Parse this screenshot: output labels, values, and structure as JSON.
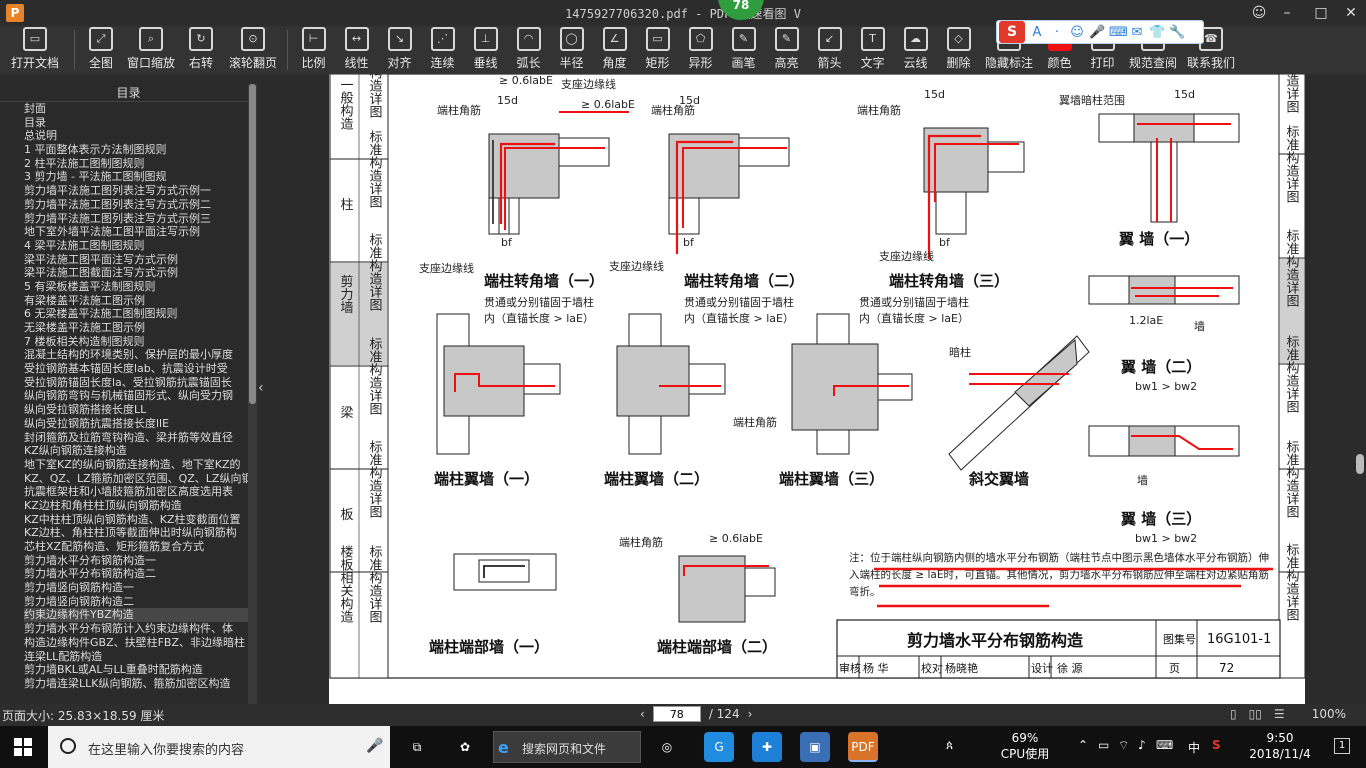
{
  "window": {
    "app_logo": "P",
    "title": "1475927706320.pdf - PDF 快速看图 V",
    "page_badge": "78",
    "buttons": [
      "user-icon",
      "minimize-icon",
      "maximize-icon",
      "close-icon"
    ]
  },
  "ime_bar": {
    "logo": "S",
    "glyphs": [
      "A",
      "·",
      "☺",
      "🎤",
      "⌨",
      "✉",
      "👕",
      "🔧"
    ]
  },
  "toolbar": {
    "items": [
      {
        "label": "打开文档",
        "icon": "folder-icon"
      },
      {
        "label": "全图",
        "icon": "fit-page-icon"
      },
      {
        "label": "窗口缩放",
        "icon": "zoom-icon"
      },
      {
        "label": "右转",
        "icon": "rotate-icon"
      },
      {
        "label": "滚轮翻页",
        "icon": "mouse-icon"
      },
      {
        "label": "比例",
        "icon": "scale-icon"
      },
      {
        "label": "线性",
        "icon": "linear-measure-icon"
      },
      {
        "label": "对齐",
        "icon": "align-measure-icon"
      },
      {
        "label": "连续",
        "icon": "continuous-measure-icon"
      },
      {
        "label": "垂线",
        "icon": "perpendicular-icon"
      },
      {
        "label": "弧长",
        "icon": "arc-length-icon"
      },
      {
        "label": "半径",
        "icon": "radius-icon"
      },
      {
        "label": "角度",
        "icon": "angle-icon"
      },
      {
        "label": "矩形",
        "icon": "rectangle-icon"
      },
      {
        "label": "异形",
        "icon": "polygon-icon"
      },
      {
        "label": "画笔",
        "icon": "pen-icon"
      },
      {
        "label": "高亮",
        "icon": "highlight-icon"
      },
      {
        "label": "箭头",
        "icon": "arrow-icon"
      },
      {
        "label": "文字",
        "icon": "text-icon"
      },
      {
        "label": "云线",
        "icon": "cloud-icon"
      },
      {
        "label": "删除",
        "icon": "eraser-icon"
      },
      {
        "label": "隐藏标注",
        "icon": "hide-annotation-icon"
      },
      {
        "label": "颜色",
        "icon": "color-swatch-icon"
      },
      {
        "label": "打印",
        "icon": "print-icon"
      },
      {
        "label": "规范查阅",
        "icon": "spec-lookup-icon"
      },
      {
        "label": "联系我们",
        "icon": "contact-icon"
      }
    ],
    "accent_color": "#ee1111"
  },
  "sidebar": {
    "header": "目录",
    "selected_index": 44,
    "items": [
      {
        "label": "封面",
        "expandable": false
      },
      {
        "label": "目录",
        "expandable": false
      },
      {
        "label": "总说明",
        "expandable": false
      },
      {
        "label": "1 平面整体表示方法制图规则",
        "expandable": false
      },
      {
        "label": "2 柱平法施工图制图规则",
        "expandable": true
      },
      {
        "label": "3 剪力墙 - 平法施工图制图规",
        "expandable": true
      },
      {
        "label": "剪力墙平法施工图列表注写方式示例一",
        "expandable": false
      },
      {
        "label": "剪力墙平法施工图列表注写方式示例二",
        "expandable": false
      },
      {
        "label": "剪力墙平法施工图列表注写方式示例三",
        "expandable": false
      },
      {
        "label": "地下室外墙平法施工图平面注写示例",
        "expandable": false
      },
      {
        "label": "4 梁平法施工图制图规则",
        "expandable": true
      },
      {
        "label": "梁平法施工图平面注写方式示例",
        "expandable": false
      },
      {
        "label": "梁平法施工图截面注写方式示例",
        "expandable": false
      },
      {
        "label": "5 有梁板楼盖平法制图规则",
        "expandable": true
      },
      {
        "label": "有梁楼盖平法施工图示例",
        "expandable": false
      },
      {
        "label": "6 无梁楼盖平法施工图制图规则",
        "expandable": true
      },
      {
        "label": "无梁楼盖平法施工图示例",
        "expandable": false
      },
      {
        "label": "7 楼板相关构造制图规则",
        "expandable": true
      },
      {
        "label": "混凝土结构的环境类别、保护层的最小厚度",
        "expandable": false
      },
      {
        "label": "受拉钢筋基本锚固长度lab、抗震设计时受",
        "expandable": false
      },
      {
        "label": "受拉钢筋锚固长度la、受拉钢筋抗震锚固长",
        "expandable": false
      },
      {
        "label": "纵向钢筋弯钩与机械锚固形式、纵向受力钢",
        "expandable": false
      },
      {
        "label": "纵向受拉钢筋搭接长度LL",
        "expandable": false
      },
      {
        "label": "纵向受拉钢筋抗震搭接长度llE",
        "expandable": false
      },
      {
        "label": "封闭箍筋及拉筋弯钩构造、梁并筋等效直径",
        "expandable": false
      },
      {
        "label": "KZ纵向钢筋连接构造",
        "expandable": false
      },
      {
        "label": "地下室KZ的纵向钢筋连接构造、地下室KZ的",
        "expandable": false
      },
      {
        "label": "KZ、QZ、LZ箍筋加密区范围、QZ、LZ纵向钢",
        "expandable": false
      },
      {
        "label": "抗震框架柱和小墙肢箍筋加密区高度选用表",
        "expandable": false
      },
      {
        "label": "KZ边柱和角柱柱顶纵向钢筋构造",
        "expandable": false
      },
      {
        "label": "KZ中柱柱顶纵向钢筋构造、KZ柱变截面位置",
        "expandable": false
      },
      {
        "label": "KZ边柱、角柱柱顶等截面伸出时纵向钢筋构",
        "expandable": false
      },
      {
        "label": "芯柱XZ配筋构造、矩形箍筋复合方式",
        "expandable": false
      },
      {
        "label": "剪力墙水平分布钢筋构造一",
        "expandable": false
      },
      {
        "label": "剪力墙水平分布钢筋构造二",
        "expandable": false
      },
      {
        "label": "剪力墙竖向钢筋构造一",
        "expandable": false
      },
      {
        "label": "剪力墙竖向钢筋构造二",
        "expandable": false
      },
      {
        "label": "约束边缘构件YBZ构造",
        "expandable": false
      },
      {
        "label": "剪力墙水平分布钢筋计入约束边缘构件、体",
        "expandable": false
      },
      {
        "label": "构造边缘构件GBZ、扶壁柱FBZ、非边缘暗柱",
        "expandable": false
      },
      {
        "label": "连梁LL配筋构造",
        "expandable": false
      },
      {
        "label": "剪力墙BKL或AL与LL重叠时配筋构造",
        "expandable": false
      },
      {
        "label": "剪力墙连梁LLK纵向钢筋、箍筋加密区构造",
        "expandable": false
      }
    ]
  },
  "document": {
    "side_tabs": [
      {
        "label": "一般构造",
        "sub": "标准构造详图"
      },
      {
        "label": "柱",
        "sub": "标准构造详图"
      },
      {
        "label": "剪力墙",
        "sub": "标准构造详图"
      },
      {
        "label": "梁",
        "sub": "标准构造详图"
      },
      {
        "label": "板",
        "sub": "标准构造详图"
      },
      {
        "label": "楼板相关构造",
        "sub": "标准构造详图"
      }
    ],
    "right_tabs": [
      "标准构造详图",
      "标准构造详图",
      "标准构造详图",
      "标准构造详图",
      "标准构造详图",
      "标准构造详图"
    ],
    "captions": {
      "c1": "端柱转角墙（一）",
      "c2": "端柱转角墙（二）",
      "c3": "端柱转角墙（三）",
      "c4": "翼 墙（一）",
      "c5": "端柱翼墙（一）",
      "c6": "端柱翼墙（二）",
      "c7": "端柱翼墙（三）",
      "c8": "斜交翼墙",
      "c9": "翼 墙（二）",
      "c9b": "bw1 > bw2",
      "c10": "翼 墙（三）",
      "c10b": "bw1 > bw2",
      "c11": "端柱端部墙（一）",
      "c12": "端柱端部墙（二）"
    },
    "labels": {
      "zhibian": "支座边缘线",
      "duanzhu": "端柱角筋",
      "yiqiang_an": "翼墙暗柱范围",
      "guantong": "贯通或分别锚固于墙柱",
      "nei": "内（直锚长度 > laE）",
      "anzhu": "暗柱",
      "qiang": "墙",
      "d06": "≥ 0.6labE",
      "d15": "15d",
      "d12": "1.2laE",
      "bf": "bf",
      "bw": "bw"
    },
    "note": "注：位于端柱纵向钢筋内侧的墙水平分布钢筋（端柱节点中图示黑色墙体水平分布钢筋）伸入端柱的长度 ≥ laE时，可直锚。其他情况，剪力墙水平分布钢筋应伸至端柱对边紧贴角筋弯折。",
    "title_block": {
      "title": "剪力墙水平分布钢筋构造",
      "atlas_label": "图集号",
      "atlas": "16G101-1",
      "review": "审核",
      "reviewer": "杨 华",
      "check": "校对",
      "checker": "杨晓艳",
      "design": "设计",
      "designer": "徐 源",
      "page_label": "页",
      "page": "72"
    }
  },
  "status": {
    "size": "页面大小: 25.83×18.59 厘米",
    "current_page": "78",
    "total": "/ 124",
    "zoom": "100%"
  },
  "taskbar": {
    "search_placeholder": "在这里输入你要搜索的内容",
    "web_search": "搜索网页和文件",
    "cpu_percent": "69%",
    "cpu_label": "CPU使用",
    "lang": "中",
    "time": "9:50",
    "date": "2018/11/4",
    "notif_count": "1"
  }
}
